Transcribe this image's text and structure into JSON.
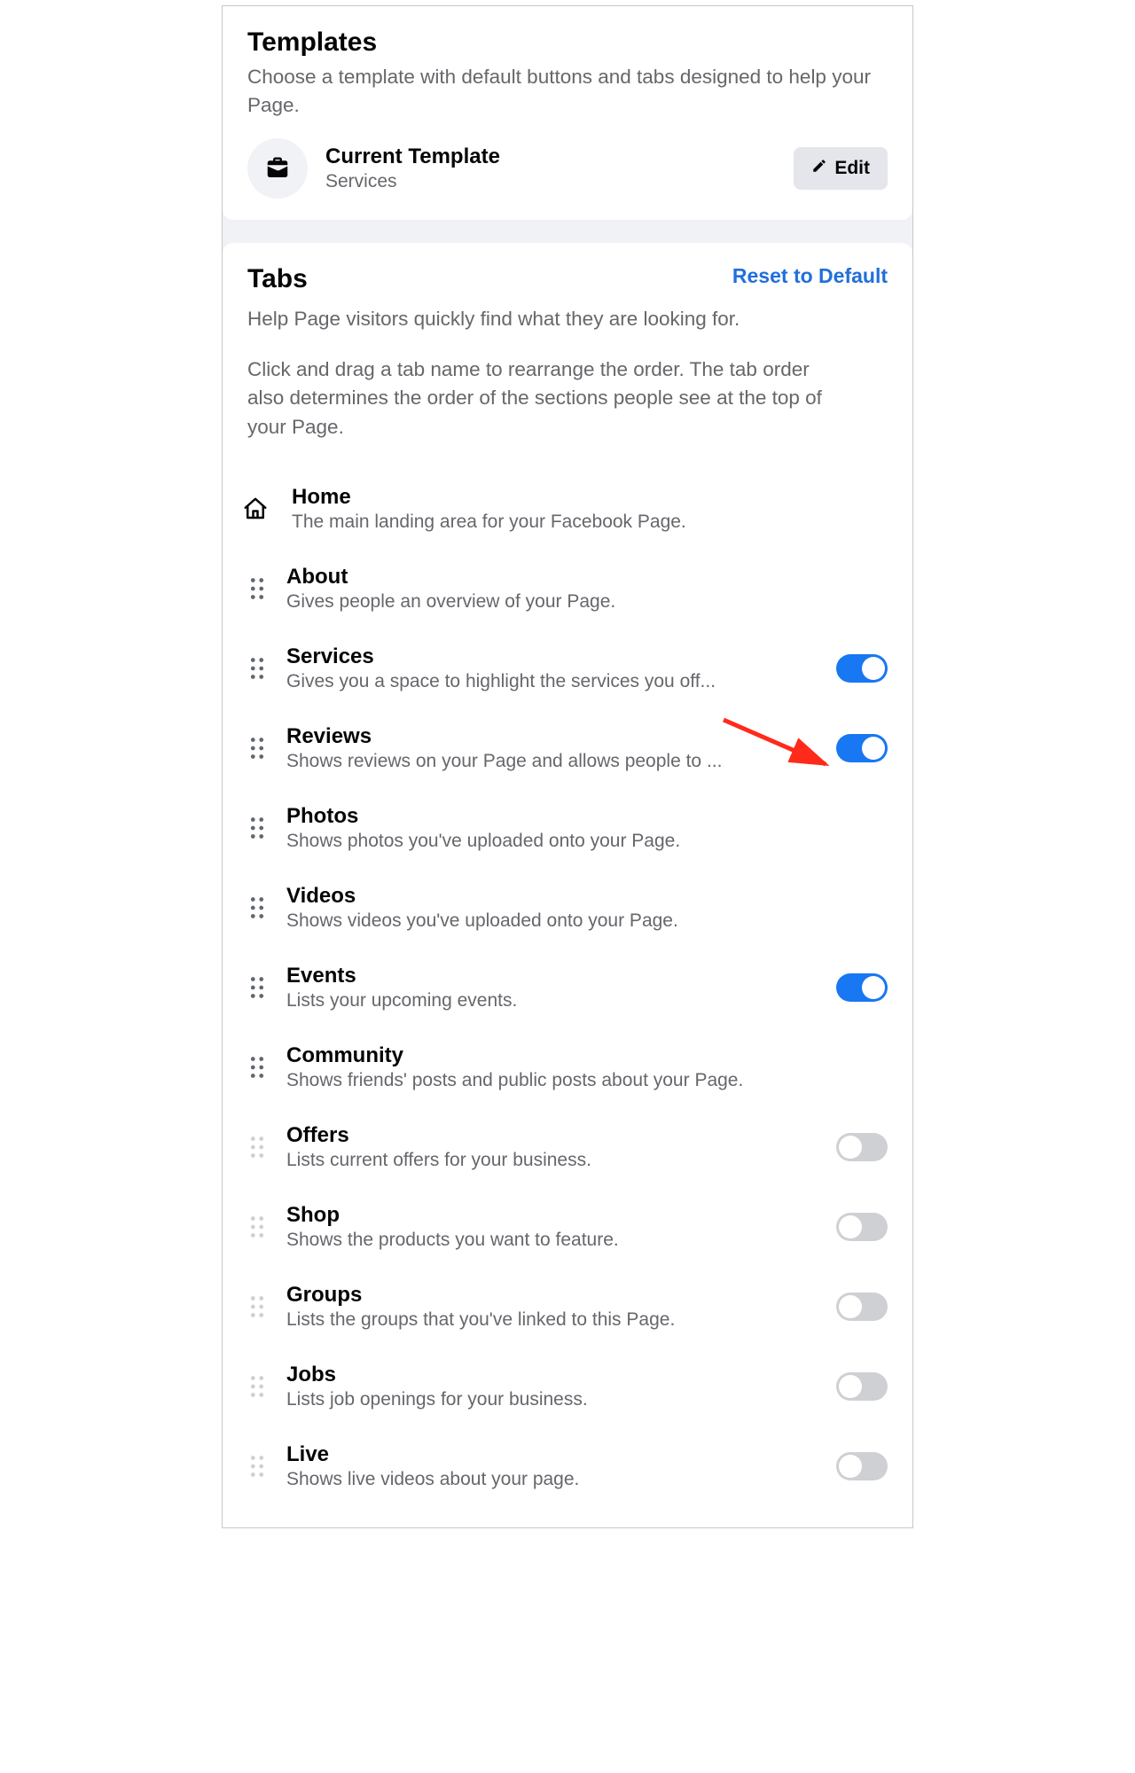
{
  "templates": {
    "heading": "Templates",
    "description": "Choose a template with default buttons and tabs designed to help your Page.",
    "current_label": "Current Template",
    "current_value": "Services",
    "edit_label": "Edit"
  },
  "tabs_section": {
    "heading": "Tabs",
    "reset_label": "Reset to Default",
    "description_1": "Help Page visitors quickly find what they are looking for.",
    "description_2": "Click and drag a tab name to rearrange the order. The tab order also determines the order of the sections people see at the top of your Page."
  },
  "tabs": [
    {
      "id": "home",
      "title": "Home",
      "subtitle": "The main landing area for your Facebook Page.",
      "icon": "home",
      "draggable": false,
      "toggle": null,
      "handle_style": "none"
    },
    {
      "id": "about",
      "title": "About",
      "subtitle": "Gives people an overview of your Page.",
      "icon": null,
      "draggable": true,
      "toggle": null,
      "handle_style": "dark"
    },
    {
      "id": "services",
      "title": "Services",
      "subtitle": "Gives you a space to highlight the services you off...",
      "icon": null,
      "draggable": true,
      "toggle": true,
      "handle_style": "dark"
    },
    {
      "id": "reviews",
      "title": "Reviews",
      "subtitle": "Shows reviews on your Page and allows people to ...",
      "icon": null,
      "draggable": true,
      "toggle": true,
      "handle_style": "dark"
    },
    {
      "id": "photos",
      "title": "Photos",
      "subtitle": "Shows photos you've uploaded onto your Page.",
      "icon": null,
      "draggable": true,
      "toggle": null,
      "handle_style": "dark"
    },
    {
      "id": "videos",
      "title": "Videos",
      "subtitle": "Shows videos you've uploaded onto your Page.",
      "icon": null,
      "draggable": true,
      "toggle": null,
      "handle_style": "dark"
    },
    {
      "id": "events",
      "title": "Events",
      "subtitle": "Lists your upcoming events.",
      "icon": null,
      "draggable": true,
      "toggle": true,
      "handle_style": "dark"
    },
    {
      "id": "community",
      "title": "Community",
      "subtitle": "Shows friends' posts and public posts about your Page.",
      "icon": null,
      "draggable": true,
      "toggle": null,
      "handle_style": "dark"
    },
    {
      "id": "offers",
      "title": "Offers",
      "subtitle": "Lists current offers for your business.",
      "icon": null,
      "draggable": true,
      "toggle": false,
      "handle_style": "light"
    },
    {
      "id": "shop",
      "title": "Shop",
      "subtitle": "Shows the products you want to feature.",
      "icon": null,
      "draggable": true,
      "toggle": false,
      "handle_style": "light"
    },
    {
      "id": "groups",
      "title": "Groups",
      "subtitle": "Lists the groups that you've linked to this Page.",
      "icon": null,
      "draggable": true,
      "toggle": false,
      "handle_style": "light"
    },
    {
      "id": "jobs",
      "title": "Jobs",
      "subtitle": "Lists job openings for your business.",
      "icon": null,
      "draggable": true,
      "toggle": false,
      "handle_style": "light"
    },
    {
      "id": "live",
      "title": "Live",
      "subtitle": "Shows live videos about your page.",
      "icon": null,
      "draggable": true,
      "toggle": false,
      "handle_style": "light"
    }
  ]
}
